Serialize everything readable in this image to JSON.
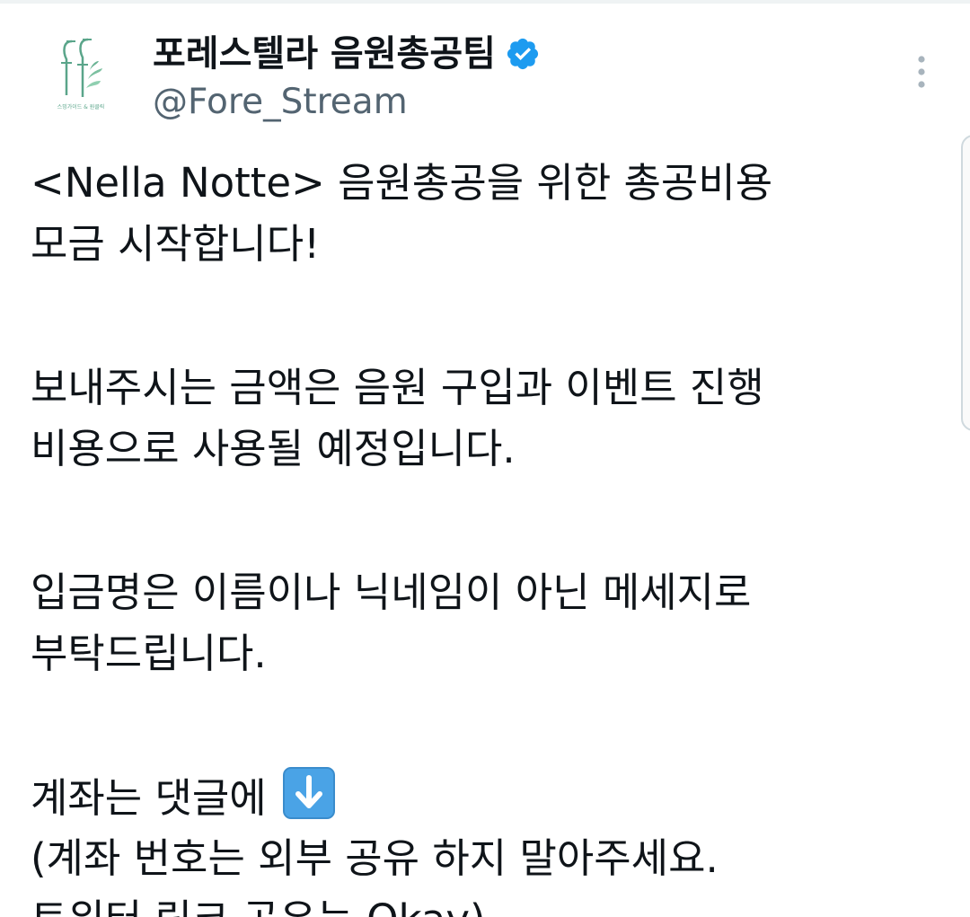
{
  "author": {
    "display_name": "포레스텔라 음원총공팀",
    "handle": "@Fore_Stream",
    "avatar_caption": "스밍가이드 & 원클릭",
    "verified": true,
    "verified_color": "#1d9bf0",
    "avatar_accent": "#5aa58a"
  },
  "tweet": {
    "line1": "<Nella Notte> 음원총공을 위한 총공비용",
    "line2": "모금 시작합니다!",
    "line3": "보내주시는 금액은 음원 구입과 이벤트 진행",
    "line4": "비용으로 사용될 예정입니다.",
    "line5": "입금명은 이름이나 닉네임이 아닌 메세지로",
    "line6": "부탁드립니다.",
    "line7": "계좌는 댓글에",
    "line7_emoji": "down-arrow-emoji",
    "line8": "(계좌 번호는 외부 공유 하지 말아주세요.",
    "line9": "트위터 링크 공유는 Okay)"
  },
  "icons": {
    "more": "more-vertical-icon",
    "verified": "verified-badge-icon"
  }
}
